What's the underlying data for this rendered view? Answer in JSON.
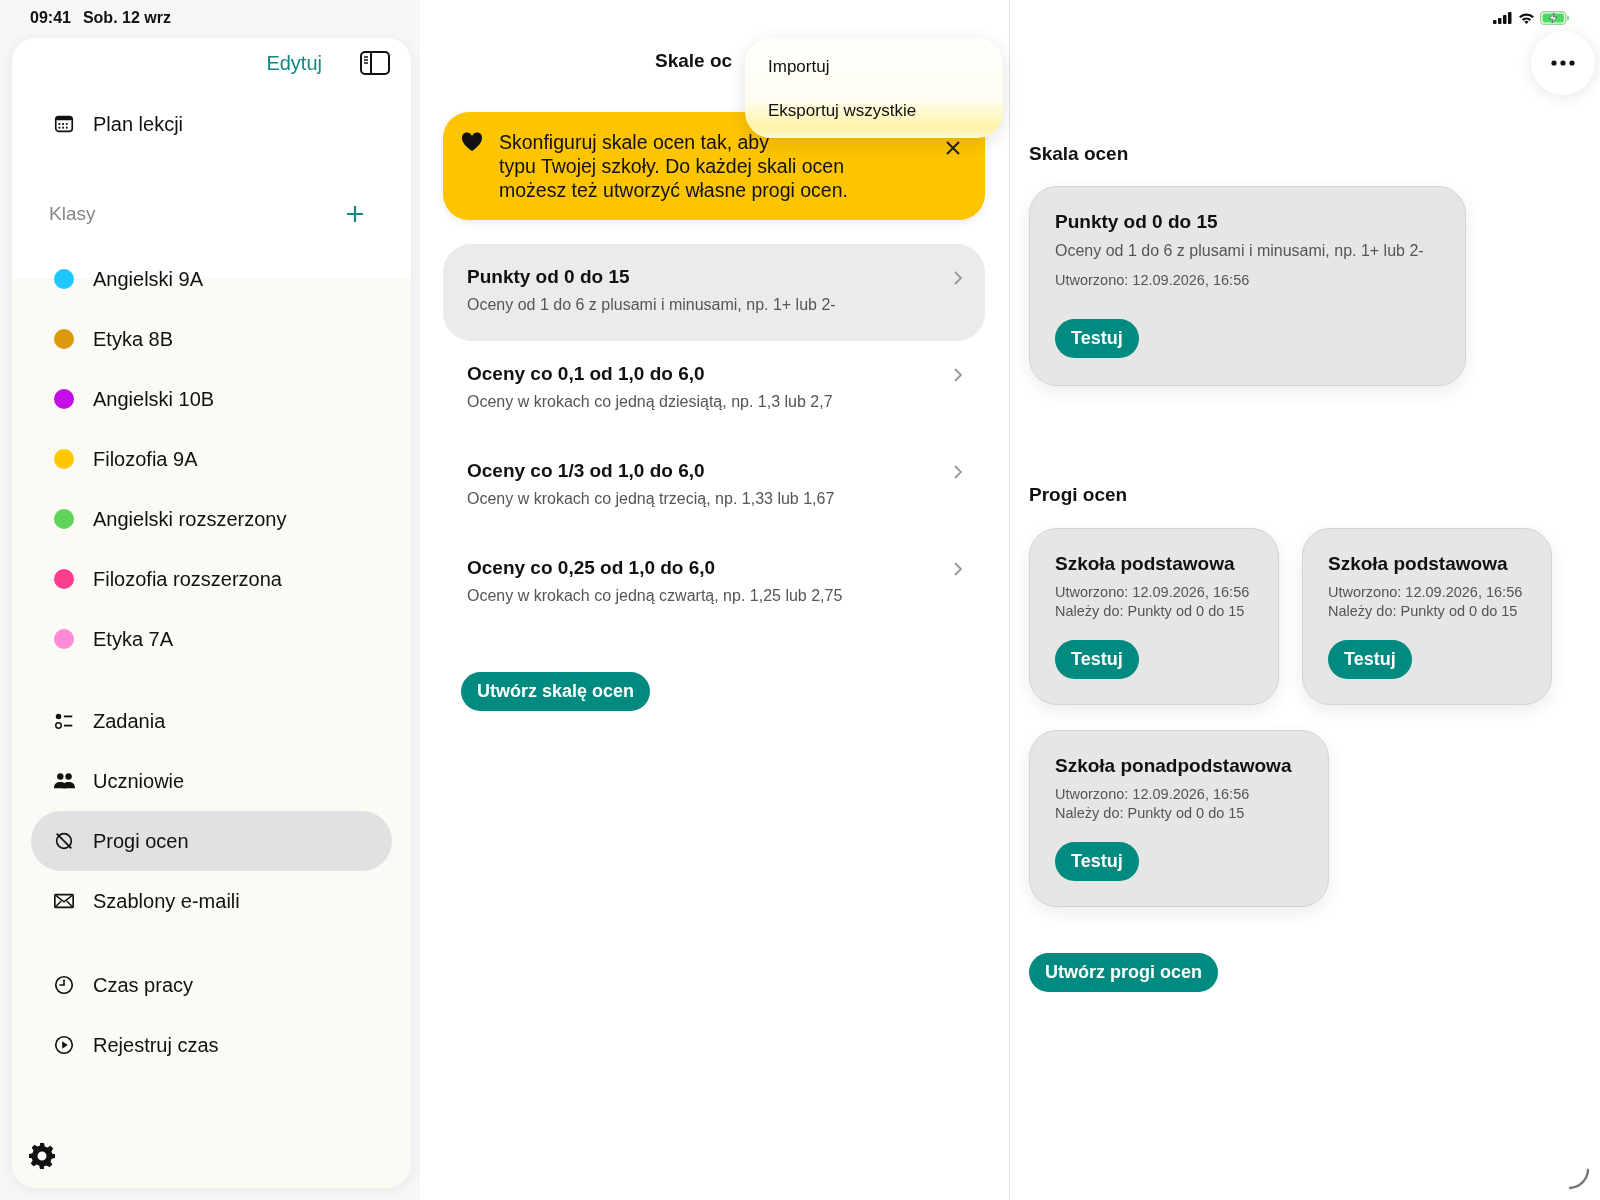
{
  "status_bar": {
    "time": "09:41",
    "date": "Sob. 12 wrz"
  },
  "sidebar": {
    "edit_label": "Edytuj",
    "top_items": [
      {
        "label": "Plan lekcji",
        "selected": false
      }
    ],
    "classes": {
      "title": "Klasy",
      "items": [
        {
          "label": "Angielski 9A",
          "color": "#1ec8ff",
          "selected": false
        },
        {
          "label": "Etyka 8B",
          "color": "#db9a0b",
          "selected": false
        },
        {
          "label": "Angielski 10B",
          "color": "#c40be8",
          "selected": false
        },
        {
          "label": "Filozofia 9A",
          "color": "#ffc800",
          "selected": false
        },
        {
          "label": "Angielski rozszerzony",
          "color": "#5fd35a",
          "selected": false
        },
        {
          "label": "Filozofia rozszerzona",
          "color": "#ff3c8e",
          "selected": false
        },
        {
          "label": "Etyka 7A",
          "color": "#ff8ad8",
          "selected": false
        }
      ]
    },
    "main_items": [
      {
        "label": "Zadania",
        "selected": false
      },
      {
        "label": "Uczniowie",
        "selected": false
      },
      {
        "label": "Progi ocen",
        "selected": true
      },
      {
        "label": "Szablony e-maili",
        "selected": false
      }
    ],
    "time_items": [
      {
        "label": "Czas pracy",
        "selected": false
      },
      {
        "label": "Rejestruj czas",
        "selected": false
      }
    ]
  },
  "list_pane": {
    "title": "Skale oc",
    "banner_lines": [
      "Skonfiguruj skale ocen tak, aby",
      "typu Twojej szkoły. Do każdej skali ocen",
      "możesz też utworzyć własne progi ocen."
    ],
    "scales": [
      {
        "title": "Punkty od 0 do 15",
        "subtitle": "Oceny od 1 do 6 z plusami i minusami, np. 1+ lub 2-",
        "selected": true
      },
      {
        "title": "Oceny co 0,1 od 1,0 do 6,0",
        "subtitle": "Oceny w krokach co jedną dziesiątą, np. 1,3 lub 2,7",
        "selected": false
      },
      {
        "title": "Oceny co 1/3 od 1,0 do 6,0",
        "subtitle": "Oceny w krokach co jedną trzecią, np. 1,33 lub 1,67",
        "selected": false
      },
      {
        "title": "Oceny co 0,25 od 1,0 do 6,0",
        "subtitle": "Oceny w krokach co jedną czwartą, np. 1,25 lub 2,75",
        "selected": false
      }
    ],
    "create_button": "Utwórz skalę ocen"
  },
  "menu": {
    "items": [
      "Importuj",
      "Eksportuj wszystkie"
    ]
  },
  "detail": {
    "scale_heading": "Skala ocen",
    "scale_card": {
      "title": "Punkty od 0 do 15",
      "description": "Oceny od 1 do 6 z plusami i minusami, np. 1+ lub 2-",
      "created": "Utworzono: 12.09.2026, 16:56",
      "button": "Testuj"
    },
    "thresholds_heading": "Progi ocen",
    "thresholds": [
      {
        "title": "Szkoła podstawowa",
        "created": "Utworzono: 12.09.2026, 16:56",
        "belongs": "Należy do: Punkty od 0 do 15",
        "button": "Testuj"
      },
      {
        "title": "Szkoła podstawowa",
        "created": "Utworzono: 12.09.2026, 16:56",
        "belongs": "Należy do: Punkty od 0 do 15",
        "button": "Testuj"
      },
      {
        "title": "Szkoła ponadpodstawowa",
        "created": "Utworzono: 12.09.2026, 16:56",
        "belongs": "Należy do: Punkty od 0 do 15",
        "button": "Testuj"
      }
    ],
    "create_button": "Utwórz progi ocen"
  }
}
